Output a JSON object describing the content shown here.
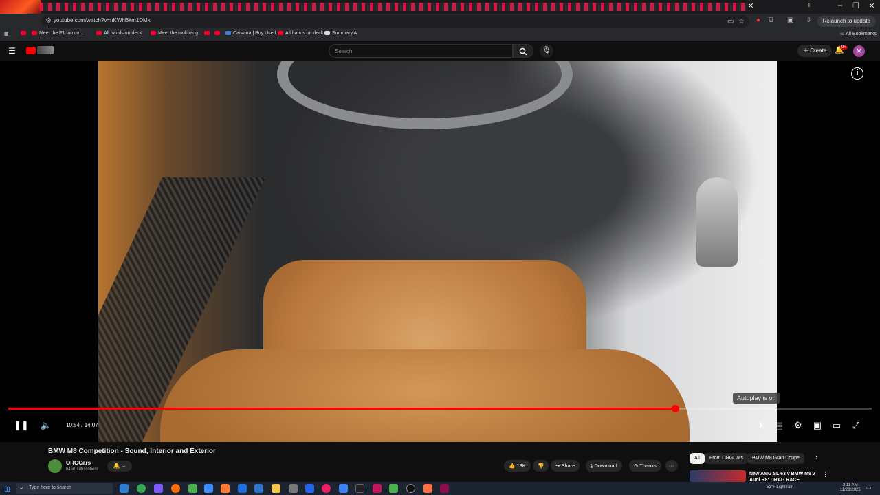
{
  "browser": {
    "url": "youtube.com/watch?v=nKWhBkm1DMk",
    "relaunch_label": "Relaunch to update",
    "all_bookmarks_label": "All Bookmarks",
    "bookmarks": [
      {
        "label": "Meet the F1 fan co..."
      },
      {
        "label": "All hands on deck"
      },
      {
        "label": "Meet the mukbang..."
      },
      {
        "label": "Carvana | Buy Used..."
      },
      {
        "label": "All hands on deck"
      },
      {
        "label": "Summary A"
      }
    ]
  },
  "header": {
    "search_placeholder": "Search",
    "create_label": "Create",
    "notifications_badge": "9+",
    "avatar_letter": "M"
  },
  "player": {
    "current_time": "10:54",
    "duration": "14:07",
    "time_display": "10:54 / 14:07",
    "progress_fraction": 0.772,
    "autoplay_tooltip": "Autoplay is on",
    "accent_color": "#ff0000"
  },
  "video": {
    "title": "BMW M8 Competition - Sound, Interior and Exterior",
    "channel": "ORGCars",
    "subscribers": "645K subscribers",
    "likes": "13K",
    "share_label": "Share",
    "download_label": "Download",
    "thanks_label": "Thanks"
  },
  "recommendations": {
    "chips": [
      "All",
      "From ORGCars",
      "BMW M8 Gran Coupe"
    ],
    "first_title": "New AMG SL 63 v BMW M8 v Audi R8: DRAG RACE"
  },
  "taskbar": {
    "search_placeholder": "Type here to search",
    "weather": "52°F  Light rain",
    "time": "3:11 AM",
    "date": "11/23/2025"
  }
}
